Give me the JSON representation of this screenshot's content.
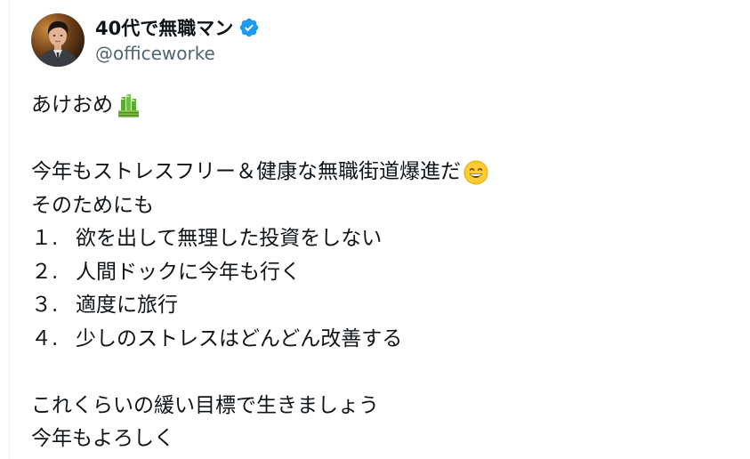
{
  "author": {
    "display_name": "40代で無職マン",
    "handle": "@officeworke",
    "verified": true,
    "avatar_icon": "profile-photo"
  },
  "tweet": {
    "line1": "あけおめ",
    "line1_emoji": "kadomatsu-icon",
    "line2": "今年もストレスフリー＆健康な無職街道爆進だ",
    "line2_emoji": "grinning-face-icon",
    "line3": "そのためにも",
    "list": [
      {
        "num": "１.",
        "text": "欲を出して無理した投資をしない"
      },
      {
        "num": "２.",
        "text": "人間ドックに今年も行く"
      },
      {
        "num": "３.",
        "text": "適度に旅行"
      },
      {
        "num": "４.",
        "text": "少しのストレスはどんどん改善する"
      }
    ],
    "line8": "これくらいの緩い目標で生きましょう",
    "line9": "今年もよろしく"
  },
  "colors": {
    "text": "#0f1419",
    "secondary": "#536471",
    "verified": "#1d9bf0"
  }
}
